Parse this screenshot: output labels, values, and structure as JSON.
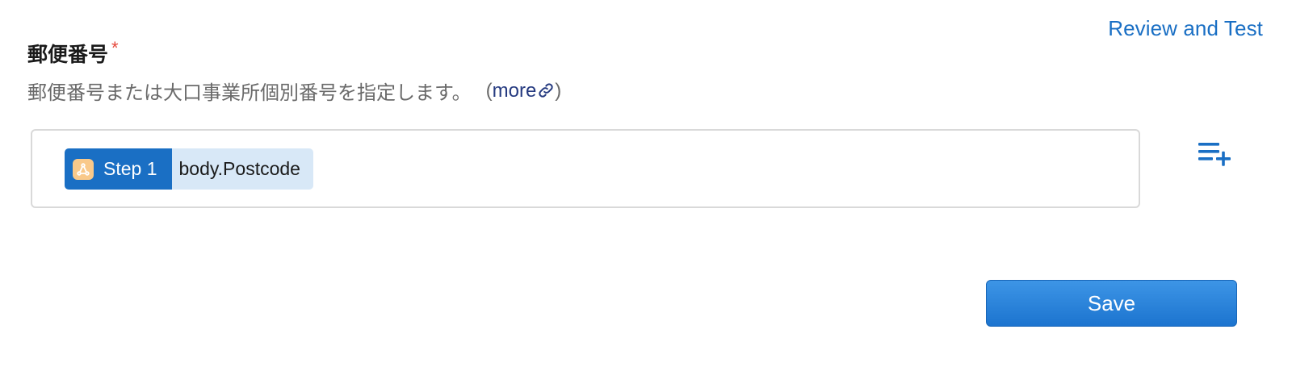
{
  "header": {
    "review_link_label": "Review and Test"
  },
  "field": {
    "label": "郵便番号",
    "required_mark": "*",
    "description": "郵便番号または大口事業所個別番号を指定します。",
    "more_open": "(",
    "more_label": "more",
    "more_close": ")"
  },
  "token": {
    "app_icon": "app-logo-icon",
    "step_label": "Step 1",
    "path_label": "body.Postcode"
  },
  "actions": {
    "insert_icon": "insert-data-icon",
    "save_label": "Save"
  },
  "colors": {
    "accent": "#1a6fc4",
    "required": "#e5483b",
    "token_path_bg": "#d8e8f7",
    "app_icon_bg": "#f9c98a"
  }
}
